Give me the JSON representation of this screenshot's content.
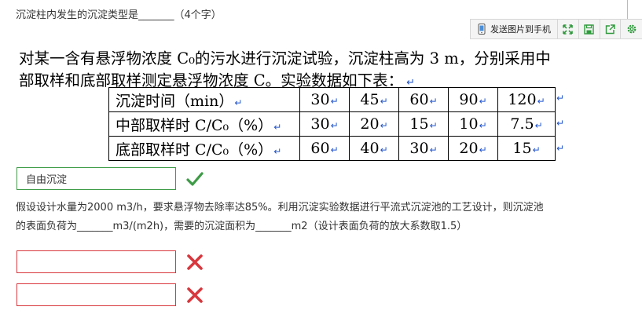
{
  "question1": {
    "text": "沉淀柱内发生的沉淀类型是_______（4个字）"
  },
  "toolbar": {
    "send_label": "发送图片到手机"
  },
  "doc": {
    "line1": "对某一含有悬浮物浓度 C₀的污水进行沉淀试验，沉淀柱高为 3 m，分别采用中",
    "line2": "部取样和底部取样测定悬浮物浓度 C。实验数据如下表：",
    "return_mark": "↵",
    "table": {
      "rows": [
        {
          "label": "沉淀时间（min）",
          "values": [
            "30",
            "45",
            "60",
            "90",
            "120"
          ]
        },
        {
          "label": "中部取样时 C/C₀（%）",
          "values": [
            "30",
            "20",
            "15",
            "10",
            "7.5"
          ]
        },
        {
          "label": "底部取样时 C/C₀（%）",
          "values": [
            "60",
            "40",
            "30",
            "20",
            "15"
          ]
        }
      ]
    }
  },
  "answer1": {
    "value": "自由沉淀",
    "status": "correct"
  },
  "question2": {
    "line1": "假设设计水量为2000 m3/h，要求悬浮物去除率达85%。利用沉淀实验数据进行平流式沉淀池的工艺设计，则沉淀池",
    "line2": "的表面负荷为_______m3/(m2h)，需要的沉淀面积为_______m2（设计表面负荷的放大系数取1.5）"
  },
  "answer2": {
    "value": "",
    "status": "wrong"
  },
  "answer3": {
    "value": "",
    "status": "wrong"
  },
  "colors": {
    "correct": "#3d9b46",
    "wrong": "#d8373d",
    "return_mark": "#2255cc"
  }
}
